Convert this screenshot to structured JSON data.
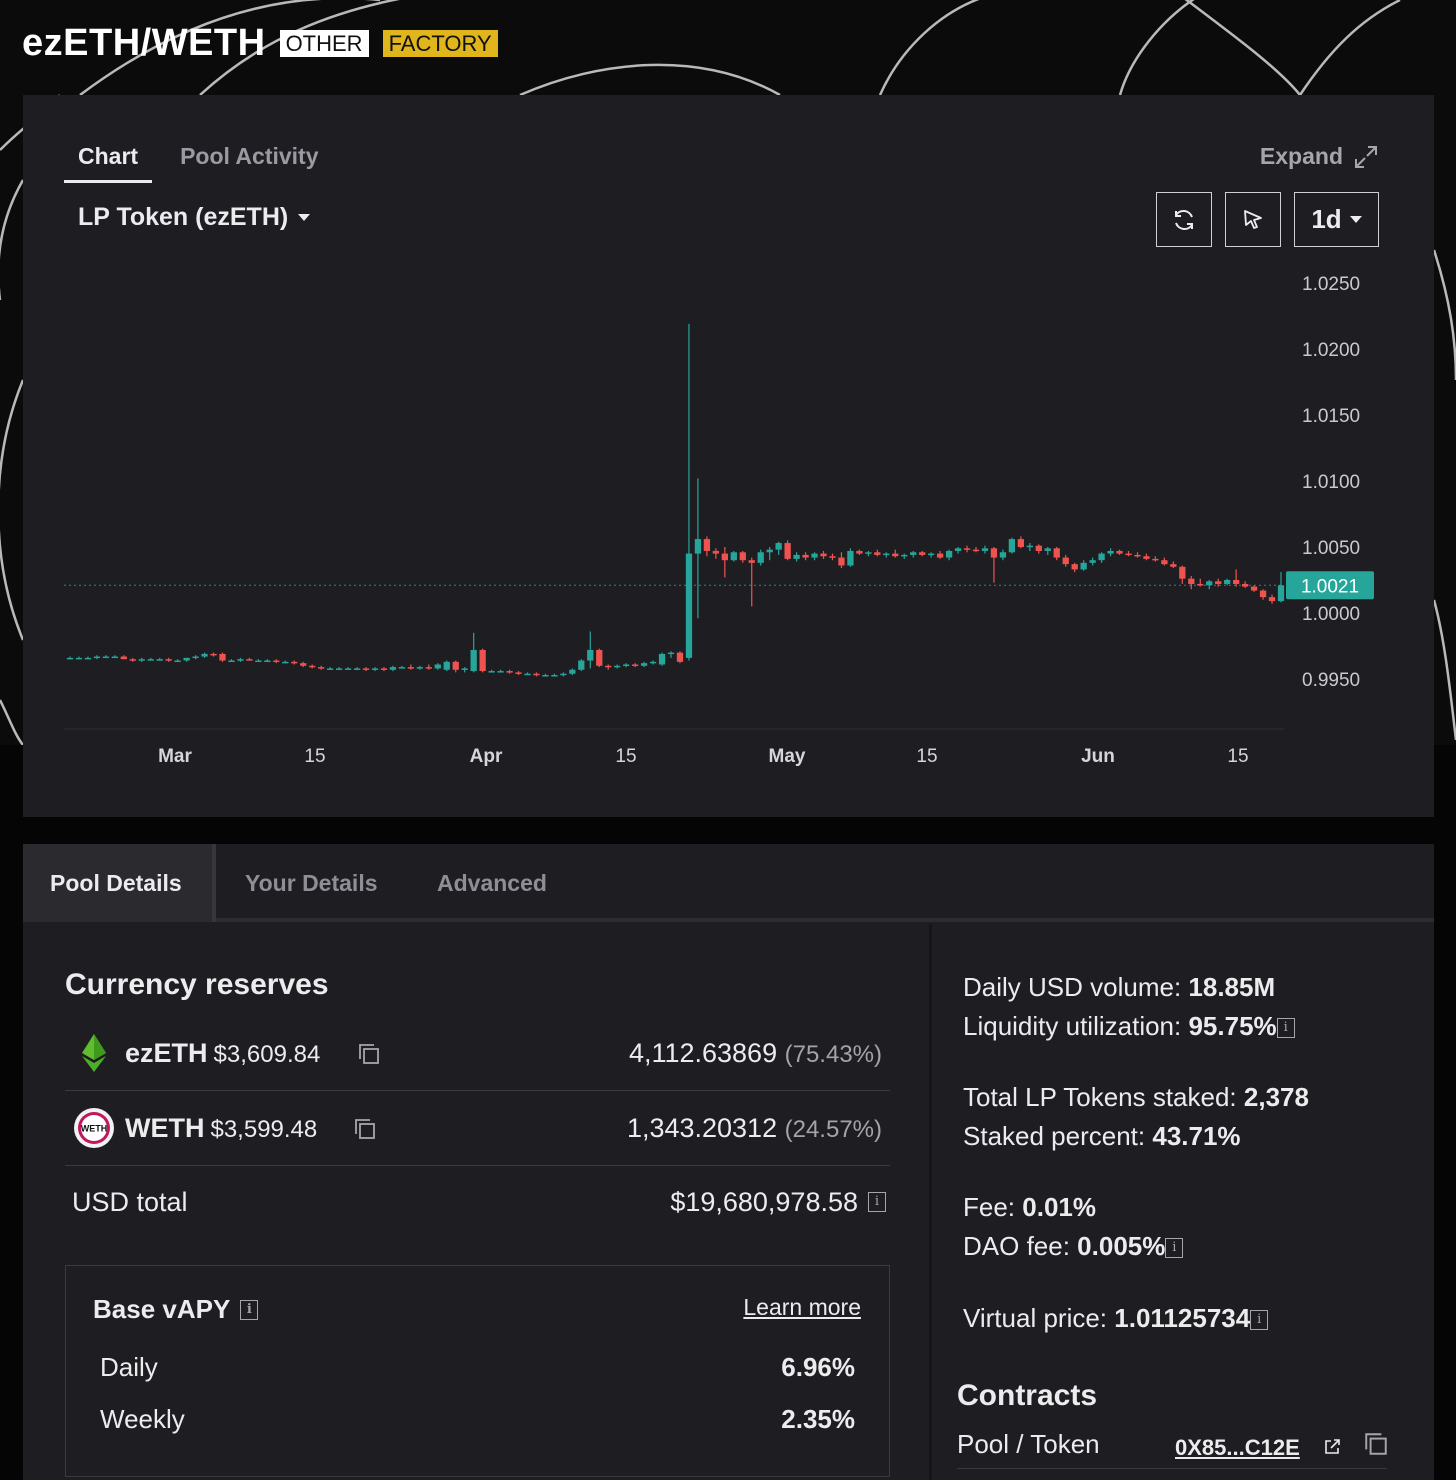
{
  "header": {
    "pool_name": "ezETH/WETH",
    "badge_other": "OTHER",
    "badge_factory": "FACTORY"
  },
  "chart_panel": {
    "tabs": [
      "Chart",
      "Pool Activity"
    ],
    "active_tab": "Chart",
    "expand_label": "Expand",
    "token_select": "LP Token (ezETH)",
    "interval": "1d",
    "current_price_label": "1.0021"
  },
  "chart_data": {
    "type": "candlestick",
    "y_ticks": [
      "1.0250",
      "1.0200",
      "1.0150",
      "1.0100",
      "1.0050",
      "1.0000",
      "0.9950"
    ],
    "x_ticks": [
      "Mar",
      "15",
      "Apr",
      "15",
      "May",
      "15",
      "Jun",
      "15"
    ],
    "ylim": [
      0.9938,
      1.025
    ],
    "current_price": 1.0021,
    "colors": {
      "up": "#26a69a",
      "down": "#ef5350",
      "price_line": "#26a69a"
    },
    "candles": [
      {
        "d": "Feb 23",
        "o": 0.9966,
        "h": 0.9967,
        "l": 0.9965,
        "c": 0.9966
      },
      {
        "d": "Feb 24",
        "o": 0.9966,
        "h": 0.9967,
        "l": 0.9965,
        "c": 0.9966
      },
      {
        "d": "Feb 25",
        "o": 0.9966,
        "h": 0.9967,
        "l": 0.9965,
        "c": 0.9966
      },
      {
        "d": "Feb 26",
        "o": 0.9966,
        "h": 0.9968,
        "l": 0.9965,
        "c": 0.9967
      },
      {
        "d": "Feb 27",
        "o": 0.9967,
        "h": 0.9968,
        "l": 0.9966,
        "c": 0.9967
      },
      {
        "d": "Feb 28",
        "o": 0.9967,
        "h": 0.9968,
        "l": 0.9966,
        "c": 0.9967
      },
      {
        "d": "Feb 29",
        "o": 0.9967,
        "h": 0.9968,
        "l": 0.9965,
        "c": 0.9965
      },
      {
        "d": "Mar 1",
        "o": 0.9965,
        "h": 0.9966,
        "l": 0.9963,
        "c": 0.9964
      },
      {
        "d": "Mar 2",
        "o": 0.9964,
        "h": 0.9966,
        "l": 0.9963,
        "c": 0.9965
      },
      {
        "d": "Mar 3",
        "o": 0.9965,
        "h": 0.9966,
        "l": 0.9964,
        "c": 0.9965
      },
      {
        "d": "Mar 4",
        "o": 0.9965,
        "h": 0.9966,
        "l": 0.9964,
        "c": 0.9965
      },
      {
        "d": "Mar 5",
        "o": 0.9965,
        "h": 0.9966,
        "l": 0.9963,
        "c": 0.9964
      },
      {
        "d": "Mar 6",
        "o": 0.9964,
        "h": 0.9965,
        "l": 0.9963,
        "c": 0.9964
      },
      {
        "d": "Mar 7",
        "o": 0.9964,
        "h": 0.9966,
        "l": 0.9963,
        "c": 0.9966
      },
      {
        "d": "Mar 8",
        "o": 0.9966,
        "h": 0.9968,
        "l": 0.9965,
        "c": 0.9967
      },
      {
        "d": "Mar 9",
        "o": 0.9967,
        "h": 0.997,
        "l": 0.9966,
        "c": 0.9969
      },
      {
        "d": "Mar 10",
        "o": 0.9969,
        "h": 0.997,
        "l": 0.9967,
        "c": 0.9968
      },
      {
        "d": "Mar 11",
        "o": 0.9969,
        "h": 0.997,
        "l": 0.9963,
        "c": 0.9964
      },
      {
        "d": "Mar 12",
        "o": 0.9964,
        "h": 0.9965,
        "l": 0.9963,
        "c": 0.9964
      },
      {
        "d": "Mar 13",
        "o": 0.9964,
        "h": 0.9966,
        "l": 0.9963,
        "c": 0.9965
      },
      {
        "d": "Mar 14",
        "o": 0.9965,
        "h": 0.9966,
        "l": 0.9964,
        "c": 0.9964
      },
      {
        "d": "Mar 15",
        "o": 0.9964,
        "h": 0.9965,
        "l": 0.9963,
        "c": 0.9964
      },
      {
        "d": "Mar 16",
        "o": 0.9964,
        "h": 0.9965,
        "l": 0.9963,
        "c": 0.9964
      },
      {
        "d": "Mar 17",
        "o": 0.9964,
        "h": 0.9965,
        "l": 0.9962,
        "c": 0.9963
      },
      {
        "d": "Mar 18",
        "o": 0.9963,
        "h": 0.9964,
        "l": 0.9962,
        "c": 0.9963
      },
      {
        "d": "Mar 19",
        "o": 0.9963,
        "h": 0.9964,
        "l": 0.9961,
        "c": 0.9962
      },
      {
        "d": "Mar 20",
        "o": 0.9962,
        "h": 0.9963,
        "l": 0.9959,
        "c": 0.996
      },
      {
        "d": "Mar 21",
        "o": 0.996,
        "h": 0.9961,
        "l": 0.9958,
        "c": 0.9959
      },
      {
        "d": "Mar 22",
        "o": 0.9959,
        "h": 0.996,
        "l": 0.9957,
        "c": 0.9958
      },
      {
        "d": "Mar 23",
        "o": 0.9958,
        "h": 0.9959,
        "l": 0.9957,
        "c": 0.9958
      },
      {
        "d": "Mar 24",
        "o": 0.9958,
        "h": 0.9959,
        "l": 0.9957,
        "c": 0.9958
      },
      {
        "d": "Mar 25",
        "o": 0.9958,
        "h": 0.9959,
        "l": 0.9957,
        "c": 0.9958
      },
      {
        "d": "Mar 26",
        "o": 0.9958,
        "h": 0.9959,
        "l": 0.9957,
        "c": 0.9958
      },
      {
        "d": "Mar 27",
        "o": 0.9958,
        "h": 0.9959,
        "l": 0.9956,
        "c": 0.9957
      },
      {
        "d": "Mar 28",
        "o": 0.9957,
        "h": 0.9959,
        "l": 0.9956,
        "c": 0.9958
      },
      {
        "d": "Mar 29",
        "o": 0.9958,
        "h": 0.9959,
        "l": 0.9956,
        "c": 0.9957
      },
      {
        "d": "Mar 30",
        "o": 0.9957,
        "h": 0.996,
        "l": 0.9956,
        "c": 0.9959
      },
      {
        "d": "Mar 31",
        "o": 0.9959,
        "h": 0.996,
        "l": 0.9958,
        "c": 0.9959
      },
      {
        "d": "Apr 1",
        "o": 0.9959,
        "h": 0.9961,
        "l": 0.9957,
        "c": 0.9958
      },
      {
        "d": "Apr 2",
        "o": 0.9958,
        "h": 0.996,
        "l": 0.9957,
        "c": 0.9959
      },
      {
        "d": "Apr 3",
        "o": 0.9959,
        "h": 0.9961,
        "l": 0.9957,
        "c": 0.9958
      },
      {
        "d": "Apr 4",
        "o": 0.9958,
        "h": 0.9962,
        "l": 0.9957,
        "c": 0.9961
      },
      {
        "d": "Apr 5",
        "o": 0.9957,
        "h": 0.9964,
        "l": 0.9956,
        "c": 0.9963
      },
      {
        "d": "Apr 6",
        "o": 0.9963,
        "h": 0.9964,
        "l": 0.9955,
        "c": 0.9957
      },
      {
        "d": "Apr 7",
        "o": 0.9957,
        "h": 0.9959,
        "l": 0.9955,
        "c": 0.9958
      },
      {
        "d": "Apr 8",
        "o": 0.9956,
        "h": 0.9985,
        "l": 0.9955,
        "c": 0.9972
      },
      {
        "d": "Apr 9",
        "o": 0.9972,
        "h": 0.9973,
        "l": 0.9955,
        "c": 0.9956
      },
      {
        "d": "Apr 10",
        "o": 0.9956,
        "h": 0.9957,
        "l": 0.9955,
        "c": 0.9956
      },
      {
        "d": "Apr 11",
        "o": 0.9956,
        "h": 0.9957,
        "l": 0.9955,
        "c": 0.9956
      },
      {
        "d": "Apr 12",
        "o": 0.9956,
        "h": 0.9957,
        "l": 0.9954,
        "c": 0.9955
      },
      {
        "d": "Apr 13",
        "o": 0.9955,
        "h": 0.9956,
        "l": 0.9953,
        "c": 0.9954
      },
      {
        "d": "Apr 14",
        "o": 0.9954,
        "h": 0.9955,
        "l": 0.9953,
        "c": 0.9954
      },
      {
        "d": "Apr 15",
        "o": 0.9954,
        "h": 0.9955,
        "l": 0.9952,
        "c": 0.9953
      },
      {
        "d": "Apr 16",
        "o": 0.9953,
        "h": 0.9954,
        "l": 0.9952,
        "c": 0.9953
      },
      {
        "d": "Apr 17",
        "o": 0.9953,
        "h": 0.9954,
        "l": 0.9952,
        "c": 0.9953
      },
      {
        "d": "Apr 18",
        "o": 0.9953,
        "h": 0.9955,
        "l": 0.9952,
        "c": 0.9954
      },
      {
        "d": "Apr 19",
        "o": 0.9954,
        "h": 0.9958,
        "l": 0.9953,
        "c": 0.9957
      },
      {
        "d": "Apr 20",
        "o": 0.9957,
        "h": 0.9965,
        "l": 0.9956,
        "c": 0.9964
      },
      {
        "d": "Apr 21",
        "o": 0.9964,
        "h": 0.9986,
        "l": 0.9958,
        "c": 0.9972
      },
      {
        "d": "Apr 22",
        "o": 0.9972,
        "h": 0.9973,
        "l": 0.9959,
        "c": 0.996
      },
      {
        "d": "Apr 23",
        "o": 0.996,
        "h": 0.9961,
        "l": 0.9957,
        "c": 0.9959
      },
      {
        "d": "Apr 24",
        "o": 0.9959,
        "h": 0.9961,
        "l": 0.9958,
        "c": 0.996
      },
      {
        "d": "Apr 25",
        "o": 0.996,
        "h": 0.9962,
        "l": 0.9959,
        "c": 0.9961
      },
      {
        "d": "Apr 26",
        "o": 0.9961,
        "h": 0.9962,
        "l": 0.9959,
        "c": 0.996
      },
      {
        "d": "Apr 27",
        "o": 0.996,
        "h": 0.9963,
        "l": 0.9959,
        "c": 0.9962
      },
      {
        "d": "Apr 28",
        "o": 0.9962,
        "h": 0.9964,
        "l": 0.9961,
        "c": 0.9963
      },
      {
        "d": "Apr 29",
        "o": 0.9961,
        "h": 0.997,
        "l": 0.996,
        "c": 0.9969
      },
      {
        "d": "Apr 30",
        "o": 0.9969,
        "h": 0.9971,
        "l": 0.9966,
        "c": 0.997
      },
      {
        "d": "May 1",
        "o": 0.997,
        "h": 0.9971,
        "l": 0.9962,
        "c": 0.9963
      },
      {
        "d": "May 2",
        "o": 0.9966,
        "h": 1.0219,
        "l": 0.9964,
        "c": 1.0045
      },
      {
        "d": "May 3",
        "o": 1.0045,
        "h": 1.0102,
        "l": 0.9996,
        "c": 1.0056
      },
      {
        "d": "May 4",
        "o": 1.0056,
        "h": 1.0058,
        "l": 1.0043,
        "c": 1.0047
      },
      {
        "d": "May 5",
        "o": 1.0047,
        "h": 1.0049,
        "l": 1.0041,
        "c": 1.0045
      },
      {
        "d": "May 6",
        "o": 1.0045,
        "h": 1.005,
        "l": 1.0027,
        "c": 1.004
      },
      {
        "d": "May 7",
        "o": 1.004,
        "h": 1.0047,
        "l": 1.0039,
        "c": 1.0046
      },
      {
        "d": "May 8",
        "o": 1.0046,
        "h": 1.0047,
        "l": 1.0038,
        "c": 1.004
      },
      {
        "d": "May 9",
        "o": 1.004,
        "h": 1.0042,
        "l": 1.0005,
        "c": 1.0038
      },
      {
        "d": "May 10",
        "o": 1.0038,
        "h": 1.0048,
        "l": 1.0036,
        "c": 1.0046
      },
      {
        "d": "May 11",
        "o": 1.0046,
        "h": 1.005,
        "l": 1.004,
        "c": 1.0048
      },
      {
        "d": "May 12",
        "o": 1.0048,
        "h": 1.0054,
        "l": 1.0044,
        "c": 1.0053
      },
      {
        "d": "May 13",
        "o": 1.0053,
        "h": 1.0055,
        "l": 1.004,
        "c": 1.0041
      },
      {
        "d": "May 14",
        "o": 1.0041,
        "h": 1.0046,
        "l": 1.0039,
        "c": 1.0044
      },
      {
        "d": "May 15",
        "o": 1.0044,
        "h": 1.0046,
        "l": 1.004,
        "c": 1.0042
      },
      {
        "d": "May 16",
        "o": 1.0042,
        "h": 1.0046,
        "l": 1.004,
        "c": 1.0045
      },
      {
        "d": "May 17",
        "o": 1.0045,
        "h": 1.0047,
        "l": 1.0041,
        "c": 1.0043
      },
      {
        "d": "May 18",
        "o": 1.0043,
        "h": 1.0045,
        "l": 1.004,
        "c": 1.0042
      },
      {
        "d": "May 19",
        "o": 1.0042,
        "h": 1.0046,
        "l": 1.0034,
        "c": 1.0036
      },
      {
        "d": "May 20",
        "o": 1.0036,
        "h": 1.0049,
        "l": 1.0035,
        "c": 1.0047
      },
      {
        "d": "May 21",
        "o": 1.0047,
        "h": 1.0048,
        "l": 1.0044,
        "c": 1.0045
      },
      {
        "d": "May 22",
        "o": 1.0045,
        "h": 1.0047,
        "l": 1.0043,
        "c": 1.0046
      },
      {
        "d": "May 23",
        "o": 1.0046,
        "h": 1.0048,
        "l": 1.0043,
        "c": 1.0044
      },
      {
        "d": "May 24",
        "o": 1.0044,
        "h": 1.0046,
        "l": 1.0042,
        "c": 1.0045
      },
      {
        "d": "May 25",
        "o": 1.0045,
        "h": 1.0048,
        "l": 1.0042,
        "c": 1.0043
      },
      {
        "d": "May 26",
        "o": 1.0043,
        "h": 1.0045,
        "l": 1.0041,
        "c": 1.0044
      },
      {
        "d": "May 27",
        "o": 1.0044,
        "h": 1.0047,
        "l": 1.0042,
        "c": 1.0046
      },
      {
        "d": "May 28",
        "o": 1.0046,
        "h": 1.0047,
        "l": 1.0043,
        "c": 1.0044
      },
      {
        "d": "May 29",
        "o": 1.0044,
        "h": 1.0046,
        "l": 1.0042,
        "c": 1.0045
      },
      {
        "d": "May 30",
        "o": 1.0045,
        "h": 1.0047,
        "l": 1.0041,
        "c": 1.0042
      },
      {
        "d": "May 31",
        "o": 1.0042,
        "h": 1.0048,
        "l": 1.004,
        "c": 1.0047
      },
      {
        "d": "Jun 1",
        "o": 1.0047,
        "h": 1.005,
        "l": 1.0045,
        "c": 1.0049
      },
      {
        "d": "Jun 2",
        "o": 1.0049,
        "h": 1.0051,
        "l": 1.0046,
        "c": 1.0048
      },
      {
        "d": "Jun 3",
        "o": 1.0048,
        "h": 1.005,
        "l": 1.0046,
        "c": 1.0047
      },
      {
        "d": "Jun 4",
        "o": 1.0047,
        "h": 1.0051,
        "l": 1.0045,
        "c": 1.0049
      },
      {
        "d": "Jun 5",
        "o": 1.0049,
        "h": 1.005,
        "l": 1.0023,
        "c": 1.0042
      },
      {
        "d": "Jun 6",
        "o": 1.0042,
        "h": 1.0048,
        "l": 1.004,
        "c": 1.0046
      },
      {
        "d": "Jun 7",
        "o": 1.0046,
        "h": 1.0057,
        "l": 1.0045,
        "c": 1.0056
      },
      {
        "d": "Jun 8",
        "o": 1.0056,
        "h": 1.0058,
        "l": 1.0049,
        "c": 1.005
      },
      {
        "d": "Jun 9",
        "o": 1.005,
        "h": 1.0053,
        "l": 1.0047,
        "c": 1.0051
      },
      {
        "d": "Jun 10",
        "o": 1.0051,
        "h": 1.0052,
        "l": 1.0045,
        "c": 1.0047
      },
      {
        "d": "Jun 11",
        "o": 1.0047,
        "h": 1.005,
        "l": 1.0044,
        "c": 1.0049
      },
      {
        "d": "Jun 12",
        "o": 1.0049,
        "h": 1.005,
        "l": 1.004,
        "c": 1.0042
      },
      {
        "d": "Jun 13",
        "o": 1.0042,
        "h": 1.0044,
        "l": 1.0035,
        "c": 1.0037
      },
      {
        "d": "Jun 14",
        "o": 1.0037,
        "h": 1.0038,
        "l": 1.0031,
        "c": 1.0033
      },
      {
        "d": "Jun 15",
        "o": 1.0033,
        "h": 1.004,
        "l": 1.0032,
        "c": 1.0038
      },
      {
        "d": "Jun 16",
        "o": 1.0038,
        "h": 1.0042,
        "l": 1.0036,
        "c": 1.004
      },
      {
        "d": "Jun 17",
        "o": 1.004,
        "h": 1.0046,
        "l": 1.0038,
        "c": 1.0045
      },
      {
        "d": "Jun 18",
        "o": 1.0045,
        "h": 1.0049,
        "l": 1.0043,
        "c": 1.0047
      },
      {
        "d": "Jun 19",
        "o": 1.0047,
        "h": 1.0048,
        "l": 1.0044,
        "c": 1.0045
      },
      {
        "d": "Jun 20",
        "o": 1.0045,
        "h": 1.0047,
        "l": 1.0043,
        "c": 1.0044
      },
      {
        "d": "Jun 21",
        "o": 1.0044,
        "h": 1.0046,
        "l": 1.0042,
        "c": 1.0043
      },
      {
        "d": "Jun 22",
        "o": 1.0043,
        "h": 1.0045,
        "l": 1.004,
        "c": 1.0041
      },
      {
        "d": "Jun 23",
        "o": 1.0041,
        "h": 1.0043,
        "l": 1.0039,
        "c": 1.004
      },
      {
        "d": "Jun 24",
        "o": 1.004,
        "h": 1.0042,
        "l": 1.0036,
        "c": 1.0037
      },
      {
        "d": "Jun 25",
        "o": 1.0037,
        "h": 1.0039,
        "l": 1.0034,
        "c": 1.0035
      },
      {
        "d": "Jun 26",
        "o": 1.0035,
        "h": 1.0036,
        "l": 1.0022,
        "c": 1.0026
      },
      {
        "d": "Jun 27",
        "o": 1.0026,
        "h": 1.0028,
        "l": 1.0018,
        "c": 1.0022
      },
      {
        "d": "Jun 28",
        "o": 1.0022,
        "h": 1.0026,
        "l": 1.002,
        "c": 1.0021
      },
      {
        "d": "Jun 29",
        "o": 1.0021,
        "h": 1.0025,
        "l": 1.0018,
        "c": 1.0024
      },
      {
        "d": "Jun 30",
        "o": 1.0024,
        "h": 1.0026,
        "l": 1.002,
        "c": 1.0022
      },
      {
        "d": "Jul 1",
        "o": 1.0022,
        "h": 1.0026,
        "l": 1.0021,
        "c": 1.0025
      },
      {
        "d": "Jul 2",
        "o": 1.0025,
        "h": 1.0033,
        "l": 1.002,
        "c": 1.0022
      },
      {
        "d": "Jul 3",
        "o": 1.0022,
        "h": 1.0024,
        "l": 1.0019,
        "c": 1.002
      },
      {
        "d": "Jul 4",
        "o": 1.002,
        "h": 1.0021,
        "l": 1.0016,
        "c": 1.0017
      },
      {
        "d": "Jul 5",
        "o": 1.0017,
        "h": 1.0018,
        "l": 1.001,
        "c": 1.0012
      },
      {
        "d": "Jul 6",
        "o": 1.0012,
        "h": 1.0014,
        "l": 1.0007,
        "c": 1.0009
      },
      {
        "d": "Jul 7",
        "o": 1.0009,
        "h": 1.0031,
        "l": 1.0008,
        "c": 1.0021
      }
    ]
  },
  "details": {
    "tabs": [
      "Pool Details",
      "Your Details",
      "Advanced"
    ],
    "active_tab": "Pool Details",
    "reserves_title": "Currency reserves",
    "reserves": [
      {
        "symbol": "ezETH",
        "price": "$3,609.84",
        "amount": "4,112.63869",
        "percent": "(75.43%)",
        "icon": "ezeth-icon"
      },
      {
        "symbol": "WETH",
        "price": "$3,599.48",
        "amount": "1,343.20312",
        "percent": "(24.57%)",
        "icon": "weth-icon",
        "icon_text": "WETH"
      }
    ],
    "usd_total_label": "USD total",
    "usd_total_value": "$19,680,978.58",
    "apy": {
      "title": "Base vAPY",
      "learn_more": "Learn more",
      "rows": [
        {
          "label": "Daily",
          "value": "6.96%"
        },
        {
          "label": "Weekly",
          "value": "2.35%"
        }
      ]
    },
    "stats": {
      "daily_volume_label": "Daily USD volume:",
      "daily_volume_value": "18.85M",
      "liquidity_util_label": "Liquidity utilization:",
      "liquidity_util_value": "95.75%",
      "lp_staked_label": "Total LP Tokens staked:",
      "lp_staked_value": "2,378",
      "staked_percent_label": "Staked percent:",
      "staked_percent_value": "43.71%",
      "fee_label": "Fee:",
      "fee_value": "0.01%",
      "dao_fee_label": "DAO fee:",
      "dao_fee_value": "0.005%",
      "virtual_price_label": "Virtual price:",
      "virtual_price_value": "1.01125734"
    },
    "contracts_title": "Contracts",
    "contracts": [
      {
        "label": "Pool / Token",
        "address": "0X85...C12E"
      }
    ],
    "info_glyph": "i"
  }
}
